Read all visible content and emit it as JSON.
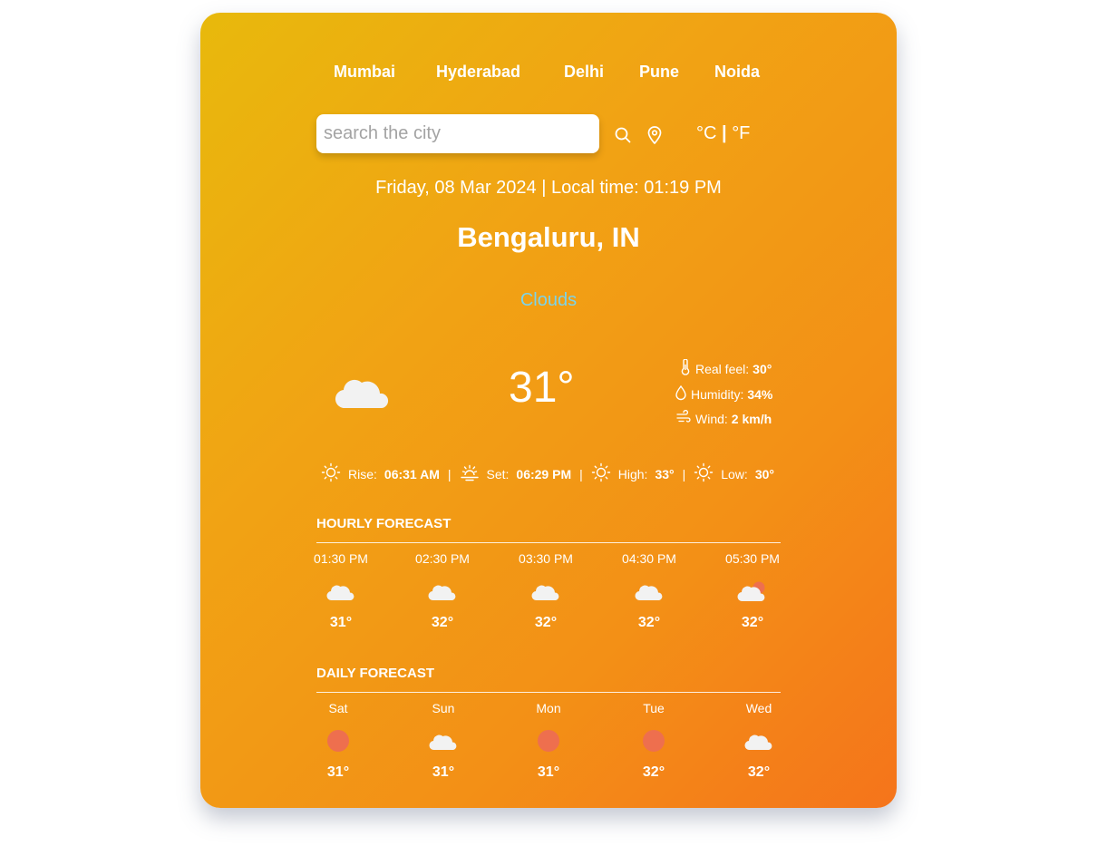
{
  "cities": [
    "Mumbai",
    "Hyderabad",
    "Delhi",
    "Pune",
    "Noida"
  ],
  "search": {
    "placeholder": "search the city"
  },
  "units": {
    "celsius": "°C",
    "separator": "|",
    "fahrenheit": "°F"
  },
  "datetime": "Friday, 08 Mar 2024 | Local time: 01:19 PM",
  "location": "Bengaluru, IN",
  "condition": "Clouds",
  "current": {
    "temp": "31°",
    "icon": "cloud-icon",
    "real_feel_label": "Real feel:",
    "real_feel": "30°",
    "humidity_label": "Humidity:",
    "humidity": "34%",
    "wind_label": "Wind:",
    "wind": "2 km/h"
  },
  "sun": {
    "rise_label": "Rise:",
    "rise": "06:31 AM",
    "set_label": "Set:",
    "set": "06:29 PM",
    "high_label": "High:",
    "high": "33°",
    "low_label": "Low:",
    "low": "30°",
    "separator": "|"
  },
  "hourly": {
    "title": "Hourly Forecast",
    "items": [
      {
        "time": "01:30 PM",
        "temp": "31°",
        "icon": "cloud-icon"
      },
      {
        "time": "02:30 PM",
        "temp": "32°",
        "icon": "cloud-icon"
      },
      {
        "time": "03:30 PM",
        "temp": "32°",
        "icon": "cloud-icon"
      },
      {
        "time": "04:30 PM",
        "temp": "32°",
        "icon": "cloud-icon"
      },
      {
        "time": "05:30 PM",
        "temp": "32°",
        "icon": "cloud-sun-icon"
      }
    ]
  },
  "daily": {
    "title": "Daily Forecast",
    "items": [
      {
        "day": "Sat",
        "temp": "31°",
        "icon": "sun-icon"
      },
      {
        "day": "Sun",
        "temp": "31°",
        "icon": "cloud-icon"
      },
      {
        "day": "Mon",
        "temp": "31°",
        "icon": "sun-icon"
      },
      {
        "day": "Tue",
        "temp": "32°",
        "icon": "sun-icon"
      },
      {
        "day": "Wed",
        "temp": "32°",
        "icon": "cloud-icon"
      }
    ]
  },
  "colors": {
    "accent_condition": "#7dd3e8",
    "sun_disc": "#ee6f4e",
    "gradient_start": "#e8b90c",
    "gradient_end": "#f5741b"
  }
}
